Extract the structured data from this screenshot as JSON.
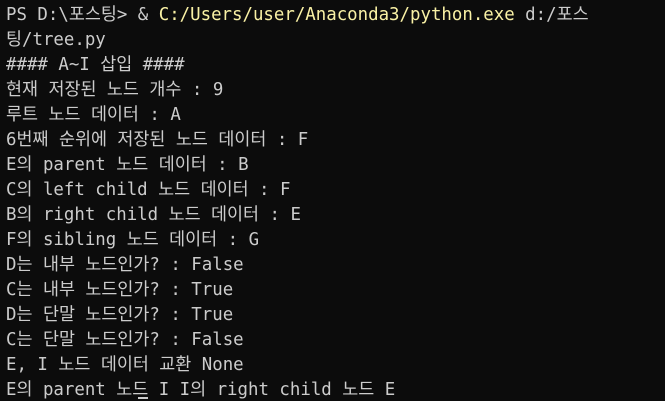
{
  "terminal": {
    "prompt": "PS D:\\포스팅> ",
    "operator": "& ",
    "exe_path": "C:/Users/user/Anaconda3/python.exe",
    "arg_part1": " d:/포스",
    "arg_part2": "팅/tree.py",
    "output": [
      "#### A~I 삽입 ####",
      "현재 저장된 노드 개수 : 9",
      "루트 노드 데이터 : A",
      "6번째 순위에 저장된 노드 데이터 : F",
      "E의 parent 노드 데이터 : B",
      "C의 left child 노드 데이터 : F",
      "B의 right child 노드 데이터 : E",
      "F의 sibling 노드 데이터 : G",
      "D는 내부 노드인가? : False",
      "C는 내부 노드인가? : True",
      "D는 단말 노드인가? : True",
      "C는 단말 노드인가? : False",
      "E, I 노드 데이터 교환 None"
    ],
    "last_line_a": "E의 parent 노드",
    "last_line_b": " I I의 right child 노드 E",
    "colors": {
      "background": "#0c0c0c",
      "text": "#cccccc",
      "path_highlight": "#f9f1a5"
    }
  }
}
